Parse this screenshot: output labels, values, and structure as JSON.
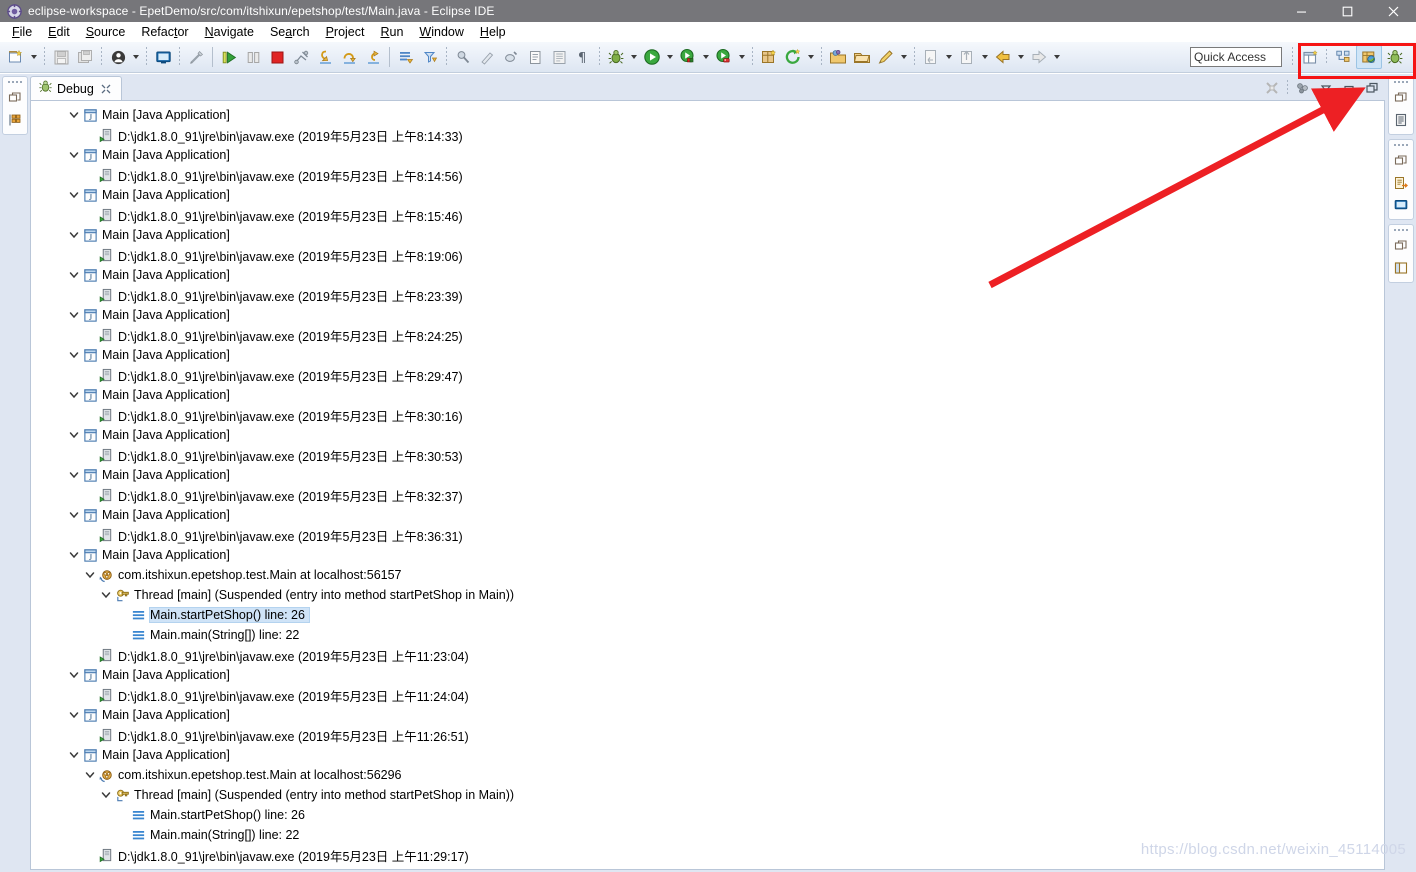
{
  "window": {
    "title": "eclipse-workspace - EpetDemo/src/com/itshixun/epetshop/test/Main.java - Eclipse IDE",
    "app_icon": "eclipse-icon",
    "controls": {
      "minimize": "minimize-icon",
      "maximize": "maximize-icon",
      "close": "close-icon"
    }
  },
  "menubar": {
    "items": [
      {
        "label": "File",
        "mnemonic": "F"
      },
      {
        "label": "Edit",
        "mnemonic": "E"
      },
      {
        "label": "Source",
        "mnemonic": "S"
      },
      {
        "label": "Refactor",
        "mnemonic": "R"
      },
      {
        "label": "Navigate",
        "mnemonic": "N"
      },
      {
        "label": "Search",
        "mnemonic": "a"
      },
      {
        "label": "Project",
        "mnemonic": "P"
      },
      {
        "label": "Run",
        "mnemonic": "R"
      },
      {
        "label": "Window",
        "mnemonic": "W"
      },
      {
        "label": "Help",
        "mnemonic": "H"
      }
    ]
  },
  "toolbar": {
    "quick_access_placeholder": "Quick Access",
    "quick_access_value": "",
    "buttons": [
      "new-wizard-icon",
      "save-icon",
      "save-all-icon",
      "skip-breakpoints-icon",
      "new-java-class-icon",
      "disconnect-icon",
      "resume-icon",
      "suspend-icon",
      "terminate-icon",
      "disconnect2-icon",
      "step-into-icon",
      "step-over-icon",
      "step-return-icon",
      "drop-to-frame-icon",
      "use-step-filters-icon",
      "run-last-tool-icon",
      "external-tools-icon",
      "search-icon",
      "open-type-icon",
      "toggle-markers-icon",
      "toggle-whitespace-icon",
      "debug-icon",
      "run-icon",
      "coverage-icon",
      "profile-icon",
      "new-package-icon",
      "refresh-icon",
      "open-perspective-icon",
      "open-folder-icon",
      "annotate-icon",
      "previous-annotation-icon",
      "next-annotation-icon",
      "back-icon",
      "forward-icon"
    ],
    "perspective_buttons": [
      {
        "name": "open-perspective-icon",
        "active": false
      },
      {
        "name": "java-perspective-icon",
        "active": false
      },
      {
        "name": "java-ee-perspective-icon",
        "active": true
      },
      {
        "name": "debug-perspective-icon",
        "active": false
      }
    ]
  },
  "trim": {
    "left_stacks": [
      {
        "icons": [
          "restore-view-icon",
          "variables-view-icon"
        ]
      }
    ],
    "right_stacks": [
      {
        "icons": [
          "restore-view-icon",
          "outline-view-icon"
        ]
      },
      {
        "icons": [
          "restore-view-icon",
          "task-list-icon",
          "console-view-icon"
        ]
      },
      {
        "icons": [
          "restore-view-icon",
          "package-explorer-icon"
        ]
      }
    ]
  },
  "view": {
    "tab_label": "Debug",
    "tab_icon": "debug-icon",
    "close_icon": "close-icon",
    "toolbar_icons": [
      "remove-all-terminated-icon",
      "view-menu-icon",
      "minimize-icon",
      "maximize-icon"
    ]
  },
  "tree": {
    "rows": [
      {
        "indent": 0,
        "twisty": "expanded",
        "icon": "launch-config-icon",
        "label": "Main [Java Application]",
        "selected": false
      },
      {
        "indent": 1,
        "twisty": "none",
        "icon": "process-icon",
        "label": "D:\\jdk1.8.0_91\\jre\\bin\\javaw.exe (2019年5月23日 上午8:14:33)",
        "selected": false
      },
      {
        "indent": 0,
        "twisty": "expanded",
        "icon": "launch-config-icon",
        "label": "Main [Java Application]",
        "selected": false
      },
      {
        "indent": 1,
        "twisty": "none",
        "icon": "process-icon",
        "label": "D:\\jdk1.8.0_91\\jre\\bin\\javaw.exe (2019年5月23日 上午8:14:56)",
        "selected": false
      },
      {
        "indent": 0,
        "twisty": "expanded",
        "icon": "launch-config-icon",
        "label": "Main [Java Application]",
        "selected": false
      },
      {
        "indent": 1,
        "twisty": "none",
        "icon": "process-icon",
        "label": "D:\\jdk1.8.0_91\\jre\\bin\\javaw.exe (2019年5月23日 上午8:15:46)",
        "selected": false
      },
      {
        "indent": 0,
        "twisty": "expanded",
        "icon": "launch-config-icon",
        "label": "Main [Java Application]",
        "selected": false
      },
      {
        "indent": 1,
        "twisty": "none",
        "icon": "process-icon",
        "label": "D:\\jdk1.8.0_91\\jre\\bin\\javaw.exe (2019年5月23日 上午8:19:06)",
        "selected": false
      },
      {
        "indent": 0,
        "twisty": "expanded",
        "icon": "launch-config-icon",
        "label": "Main [Java Application]",
        "selected": false
      },
      {
        "indent": 1,
        "twisty": "none",
        "icon": "process-icon",
        "label": "D:\\jdk1.8.0_91\\jre\\bin\\javaw.exe (2019年5月23日 上午8:23:39)",
        "selected": false
      },
      {
        "indent": 0,
        "twisty": "expanded",
        "icon": "launch-config-icon",
        "label": "Main [Java Application]",
        "selected": false
      },
      {
        "indent": 1,
        "twisty": "none",
        "icon": "process-icon",
        "label": "D:\\jdk1.8.0_91\\jre\\bin\\javaw.exe (2019年5月23日 上午8:24:25)",
        "selected": false
      },
      {
        "indent": 0,
        "twisty": "expanded",
        "icon": "launch-config-icon",
        "label": "Main [Java Application]",
        "selected": false
      },
      {
        "indent": 1,
        "twisty": "none",
        "icon": "process-icon",
        "label": "D:\\jdk1.8.0_91\\jre\\bin\\javaw.exe (2019年5月23日 上午8:29:47)",
        "selected": false
      },
      {
        "indent": 0,
        "twisty": "expanded",
        "icon": "launch-config-icon",
        "label": "Main [Java Application]",
        "selected": false
      },
      {
        "indent": 1,
        "twisty": "none",
        "icon": "process-icon",
        "label": "D:\\jdk1.8.0_91\\jre\\bin\\javaw.exe (2019年5月23日 上午8:30:16)",
        "selected": false
      },
      {
        "indent": 0,
        "twisty": "expanded",
        "icon": "launch-config-icon",
        "label": "Main [Java Application]",
        "selected": false
      },
      {
        "indent": 1,
        "twisty": "none",
        "icon": "process-icon",
        "label": "D:\\jdk1.8.0_91\\jre\\bin\\javaw.exe (2019年5月23日 上午8:30:53)",
        "selected": false
      },
      {
        "indent": 0,
        "twisty": "expanded",
        "icon": "launch-config-icon",
        "label": "Main [Java Application]",
        "selected": false
      },
      {
        "indent": 1,
        "twisty": "none",
        "icon": "process-icon",
        "label": "D:\\jdk1.8.0_91\\jre\\bin\\javaw.exe (2019年5月23日 上午8:32:37)",
        "selected": false
      },
      {
        "indent": 0,
        "twisty": "expanded",
        "icon": "launch-config-icon",
        "label": "Main [Java Application]",
        "selected": false
      },
      {
        "indent": 1,
        "twisty": "none",
        "icon": "process-icon",
        "label": "D:\\jdk1.8.0_91\\jre\\bin\\javaw.exe (2019年5月23日 上午8:36:31)",
        "selected": false
      },
      {
        "indent": 0,
        "twisty": "expanded",
        "icon": "launch-config-icon",
        "label": "Main [Java Application]",
        "selected": false
      },
      {
        "indent": 1,
        "twisty": "expanded",
        "icon": "debug-target-icon",
        "label": "com.itshixun.epetshop.test.Main at localhost:56157",
        "selected": false
      },
      {
        "indent": 2,
        "twisty": "expanded",
        "icon": "thread-icon",
        "label": "Thread [main] (Suspended (entry into method startPetShop in Main))",
        "selected": false
      },
      {
        "indent": 3,
        "twisty": "none",
        "icon": "stack-frame-icon",
        "label": "Main.startPetShop() line: 26",
        "selected": true
      },
      {
        "indent": 3,
        "twisty": "none",
        "icon": "stack-frame-icon",
        "label": "Main.main(String[]) line: 22",
        "selected": false
      },
      {
        "indent": 1,
        "twisty": "none",
        "icon": "process-icon",
        "label": "D:\\jdk1.8.0_91\\jre\\bin\\javaw.exe (2019年5月23日 上午11:23:04)",
        "selected": false
      },
      {
        "indent": 0,
        "twisty": "expanded",
        "icon": "launch-config-icon",
        "label": "Main [Java Application]",
        "selected": false
      },
      {
        "indent": 1,
        "twisty": "none",
        "icon": "process-icon",
        "label": "D:\\jdk1.8.0_91\\jre\\bin\\javaw.exe (2019年5月23日 上午11:24:04)",
        "selected": false
      },
      {
        "indent": 0,
        "twisty": "expanded",
        "icon": "launch-config-icon",
        "label": "Main [Java Application]",
        "selected": false
      },
      {
        "indent": 1,
        "twisty": "none",
        "icon": "process-icon",
        "label": "D:\\jdk1.8.0_91\\jre\\bin\\javaw.exe (2019年5月23日 上午11:26:51)",
        "selected": false
      },
      {
        "indent": 0,
        "twisty": "expanded",
        "icon": "launch-config-icon",
        "label": "Main [Java Application]",
        "selected": false
      },
      {
        "indent": 1,
        "twisty": "expanded",
        "icon": "debug-target-icon",
        "label": "com.itshixun.epetshop.test.Main at localhost:56296",
        "selected": false
      },
      {
        "indent": 2,
        "twisty": "expanded",
        "icon": "thread-icon",
        "label": "Thread [main] (Suspended (entry into method startPetShop in Main))",
        "selected": false
      },
      {
        "indent": 3,
        "twisty": "none",
        "icon": "stack-frame-icon",
        "label": "Main.startPetShop() line: 26",
        "selected": false
      },
      {
        "indent": 3,
        "twisty": "none",
        "icon": "stack-frame-icon",
        "label": "Main.main(String[]) line: 22",
        "selected": false
      },
      {
        "indent": 1,
        "twisty": "none",
        "icon": "process-icon",
        "label": "D:\\jdk1.8.0_91\\jre\\bin\\javaw.exe (2019年5月23日 上午11:29:17)",
        "selected": false
      }
    ]
  },
  "annotations": {
    "watermark": "https://blog.csdn.net/weixin_45114005",
    "highlight_color": "#f51414",
    "arrow_color": "#ed2024"
  }
}
